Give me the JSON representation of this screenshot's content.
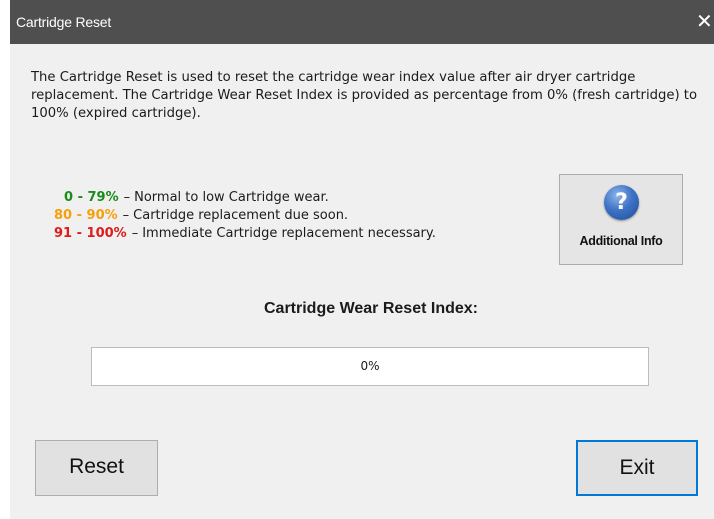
{
  "window": {
    "title": "Cartridge Reset",
    "close_glyph": "✕"
  },
  "description": "The Cartridge Reset is used to reset the cartridge wear index value after air dryer cartridge replacement. The Cartridge Wear Reset Index is provided as percentage from 0% (fresh cartridge) to 100% (expired cartridge).",
  "legend": [
    {
      "range": "0 -  79%",
      "text": "Normal to low Cartridge wear.",
      "color": "#1a8c1a"
    },
    {
      "range": "80 -  90%",
      "text": "Cartridge replacement due soon.",
      "color": "#f5a00a"
    },
    {
      "range": "91 - 100%",
      "text": "Immediate Cartridge replacement necessary.",
      "color": "#e01b1b"
    }
  ],
  "legend_dash": "–",
  "additional_info": {
    "label": "Additional Info",
    "icon": "question-icon",
    "glyph": "?"
  },
  "wear_index": {
    "label": "Cartridge Wear Reset Index:",
    "value_text": "0%",
    "fraction": 0.0
  },
  "buttons": {
    "reset_label": "Reset",
    "exit_label": "Exit"
  },
  "colors": {
    "titlebar": "#4f4f4f",
    "window_bg": "#f0f0f0",
    "focus_border": "#0078d7"
  }
}
